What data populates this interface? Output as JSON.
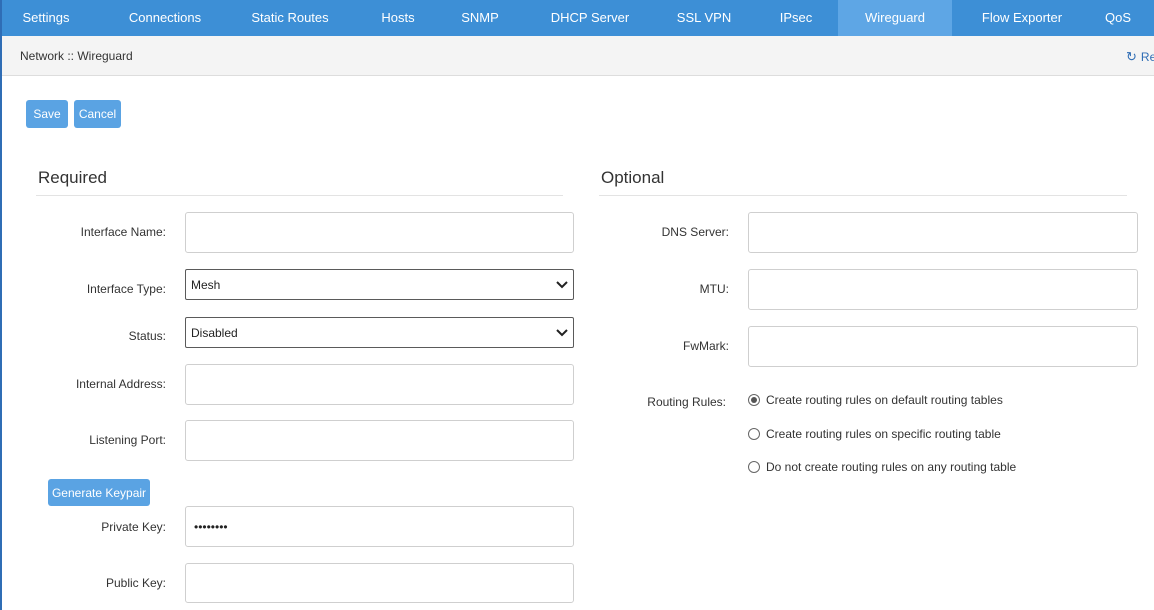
{
  "nav": {
    "tabs": [
      "Settings",
      "Connections",
      "Static Routes",
      "Hosts",
      "SNMP",
      "DHCP Server",
      "SSL VPN",
      "IPsec",
      "Wireguard",
      "Flow Exporter",
      "QoS"
    ],
    "active": "Wireguard"
  },
  "breadcrumb": "Network :: Wireguard",
  "refresh_label": "Re",
  "actions": {
    "save": "Save",
    "cancel": "Cancel"
  },
  "required": {
    "title": "Required",
    "interface_name": {
      "label": "Interface Name:",
      "value": ""
    },
    "interface_type": {
      "label": "Interface Type:",
      "value": "Mesh"
    },
    "status": {
      "label": "Status:",
      "value": "Disabled"
    },
    "internal_address": {
      "label": "Internal Address:",
      "value": ""
    },
    "listening_port": {
      "label": "Listening Port:",
      "value": ""
    },
    "generate_keypair": "Generate Keypair",
    "private_key": {
      "label": "Private Key:",
      "value": "••••••••"
    },
    "public_key": {
      "label": "Public Key:",
      "value": ""
    }
  },
  "optional": {
    "title": "Optional",
    "dns_server": {
      "label": "DNS Server:",
      "value": ""
    },
    "mtu": {
      "label": "MTU:",
      "value": ""
    },
    "fwmark": {
      "label": "FwMark:",
      "value": ""
    },
    "routing_rules": {
      "label": "Routing Rules:",
      "options": [
        "Create routing rules on default routing tables",
        "Create routing rules on specific routing table",
        "Do not create routing rules on any routing table"
      ],
      "selected": 0
    }
  },
  "colors": {
    "nav_bg": "#3d8fd6",
    "nav_active": "#5ea6e5",
    "button": "#5aa3e3",
    "accent": "#2f6db5"
  }
}
